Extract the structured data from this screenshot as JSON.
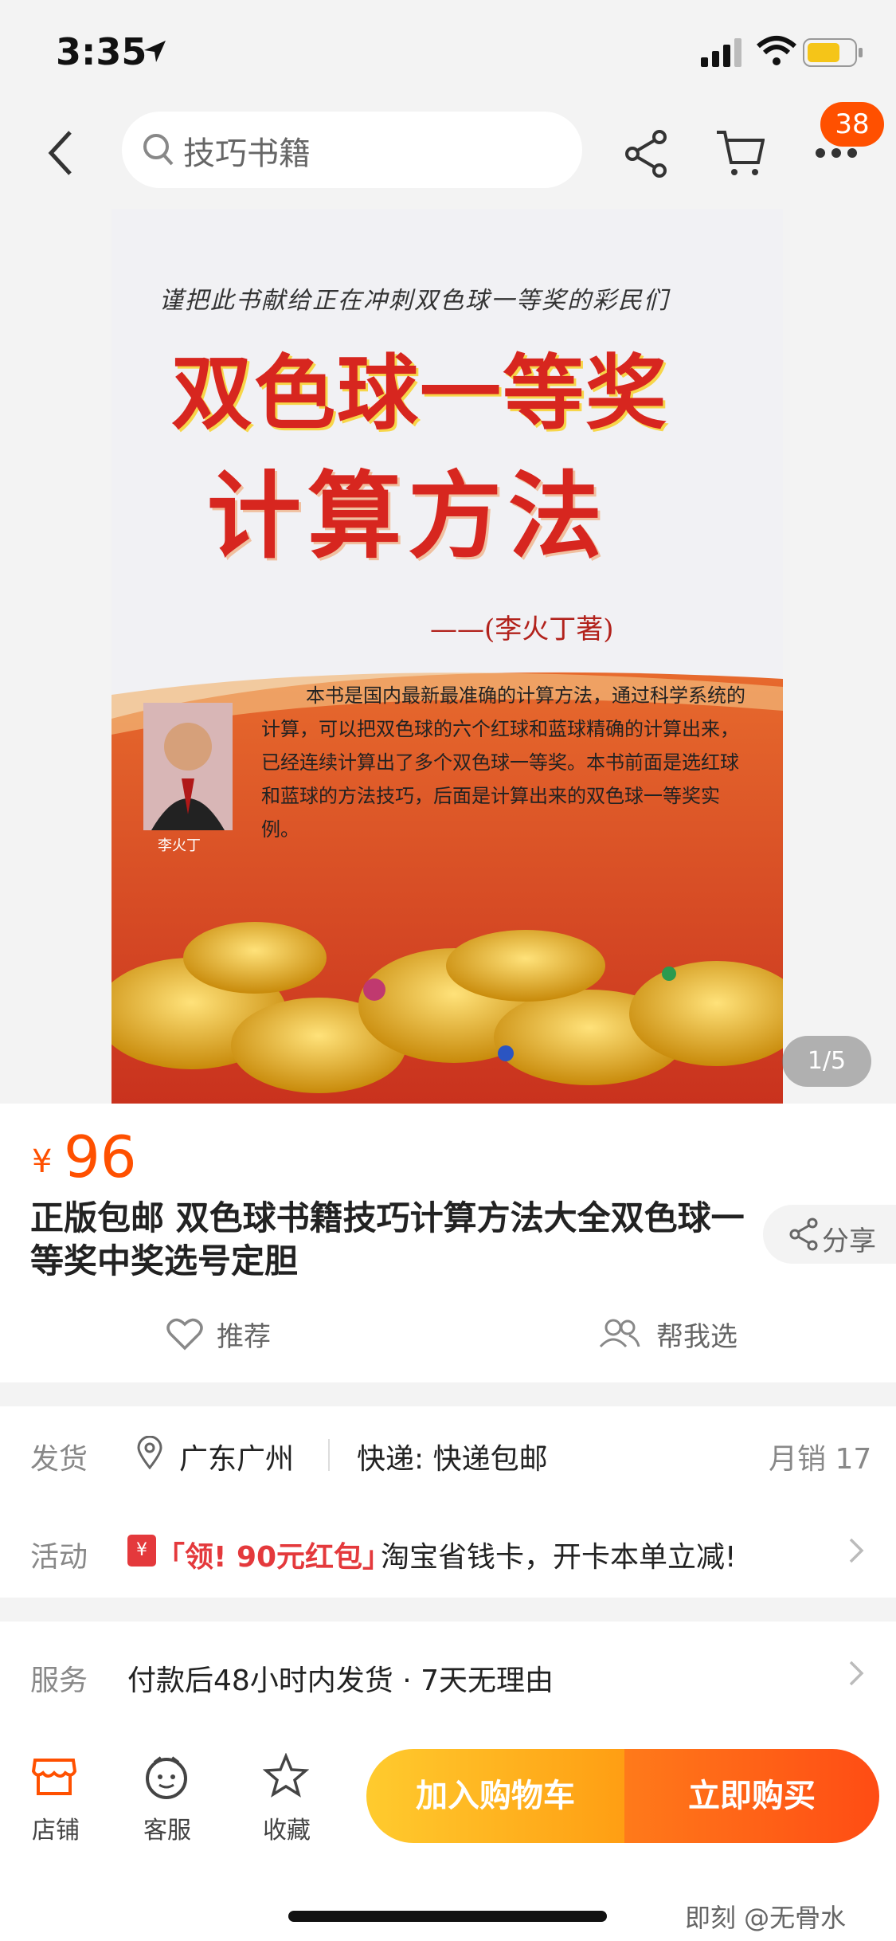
{
  "status_bar": {
    "time": "3:35"
  },
  "nav": {
    "search_placeholder": "技巧书籍",
    "cart_badge": "38"
  },
  "gallery": {
    "pager": "1/5",
    "cover": {
      "dedication": "谨把此书献给正在冲刺双色球一等奖的彩民们",
      "title_line1": "双色球一等奖",
      "title_line2": "计算方法",
      "author": "——(李火丁著)",
      "description": "本书是国内最新最准确的计算方法，通过科学系统的计算，可以把双色球的六个红球和蓝球精确的计算出来，已经连续计算出了多个双色球一等奖。本书前面是选红球和蓝球的方法技巧，后面是计算出来的双色球一等奖实例。",
      "author_caption": "李火丁"
    }
  },
  "product": {
    "currency": "¥",
    "price": "96",
    "title": "正版包邮 双色球书籍技巧计算方法大全双色球一等奖中奖选号定胆",
    "share_label": "分享",
    "recommend_label": "推荐",
    "help_choose_label": "帮我选"
  },
  "details": {
    "ship_label": "发货",
    "ship_location": "广东广州",
    "express": "快递: 快递包邮",
    "monthly_sales": "月销 17",
    "promo_label": "活动",
    "promo_tag": "「领! 90元红包」",
    "promo_text": "淘宝省钱卡，开卡本单立减!",
    "service_label": "服务",
    "service_text": "付款后48小时内发货 · 7天无理由"
  },
  "bottom_bar": {
    "store_label": "店铺",
    "service_label": "客服",
    "favorite_label": "收藏",
    "add_cart_label": "加入购物车",
    "buy_now_label": "立即购买"
  },
  "watermark": "即刻 @无骨水",
  "colors": {
    "accent": "#ff5000",
    "cart_btn": "#ffb020",
    "buy_btn": "#ff5a14"
  }
}
